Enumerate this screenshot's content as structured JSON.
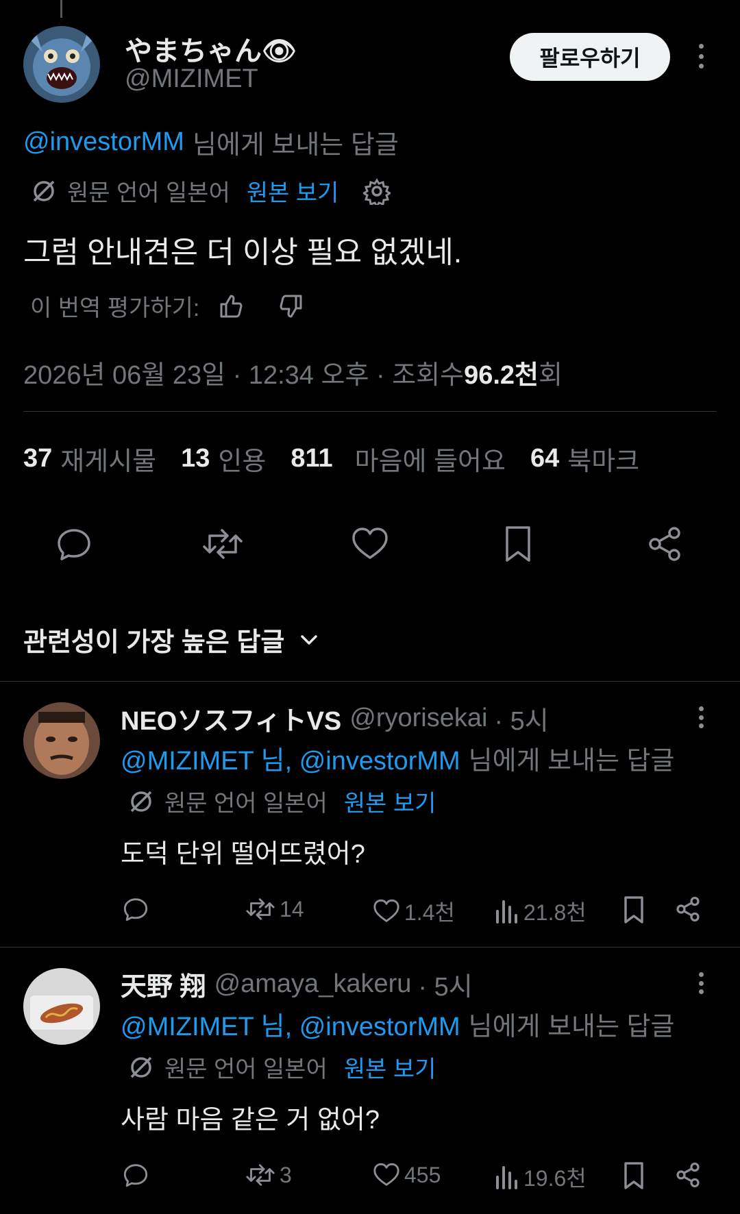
{
  "colors": {
    "background": "#000000",
    "text": "#e7e9ea",
    "muted": "#71767b",
    "link": "#1d9bf0",
    "divider": "#2f3336"
  },
  "main_post": {
    "author_name": "やまちゃん👁",
    "author_handle": "@MIZIMET",
    "follow_label": "팔로우하기",
    "reply_to_handle": "@investorMM",
    "reply_to_suffix": "님에게 보내는 답글",
    "translation_label": "원문 언어 일본어",
    "show_original": "원본 보기",
    "text": "그럼 안내견은 더 이상 필요 없겠네.",
    "rate_translation": "이 번역 평가하기:",
    "timestamp": "2026년 06월 23일 · 12:34 오후 · 조회수 ",
    "views_value": "96.2천",
    "views_suffix": "회",
    "stats": {
      "reposts_count": "37",
      "reposts_label": "재게시물",
      "quotes_count": "13",
      "quotes_label": "인용",
      "likes_count": "811",
      "likes_label": "마음에 들어요",
      "bookmarks_count": "64",
      "bookmarks_label": "북마크"
    },
    "actions": [
      "reply-icon",
      "repost-icon",
      "like-icon",
      "bookmark-icon",
      "share-icon"
    ]
  },
  "sort": {
    "label": "관련성이 가장 높은 답글"
  },
  "replies": [
    {
      "author_name": "NEOソスフィトVS",
      "author_handle": "@ryorisekai",
      "time": "· 5시",
      "reply_to_handles": "@MIZIMET 님, @investorMM",
      "reply_to_suffix": "님에게 보내는 답글",
      "translation_label": "원문 언어 일본어",
      "show_original": "원본 보기",
      "text": "도덕 단위 떨어뜨렸어?",
      "reposts": "14",
      "likes": "1.4천",
      "views": "21.8천"
    },
    {
      "author_name": "天野 翔",
      "author_handle": "@amaya_kakeru",
      "time": "· 5시",
      "reply_to_handles": "@MIZIMET 님, @investorMM",
      "reply_to_suffix": "님에게 보내는 답글",
      "translation_label": "원문 언어 일본어",
      "show_original": "원본 보기",
      "text": "사람 마음 같은 거 없어?",
      "reposts": "3",
      "likes": "455",
      "views": "19.6천"
    }
  ]
}
